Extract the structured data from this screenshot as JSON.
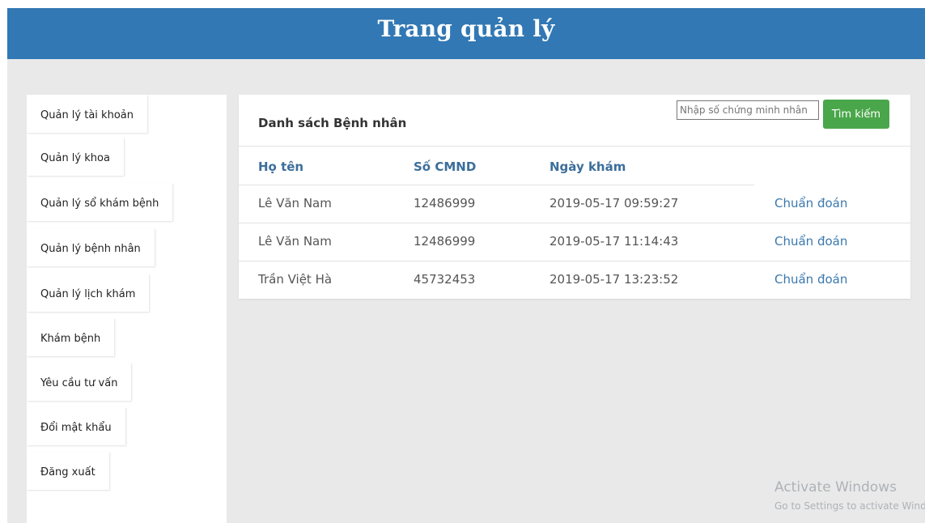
{
  "header": {
    "title": "Trang quản lý"
  },
  "sidebar": {
    "items": [
      {
        "label": "Quản lý tài khoản"
      },
      {
        "label": "Quản lý khoa"
      },
      {
        "label": "Quản lý sổ khám bệnh"
      },
      {
        "label": "Quản lý bệnh nhân"
      },
      {
        "label": "Quản lý lịch khám"
      },
      {
        "label": "Khám bệnh"
      },
      {
        "label": "Yêu cầu tư vấn"
      },
      {
        "label": "Đổi mật khẩu"
      },
      {
        "label": "Đăng xuất"
      }
    ]
  },
  "panel": {
    "title": "Danh sách Bệnh nhân",
    "search": {
      "placeholder": "Nhập số chứng minh nhân",
      "button": "Tìm kiếm"
    },
    "columns": [
      "Họ tên",
      "Số CMND",
      "Ngày khám"
    ],
    "rows": [
      {
        "name": "Lê Văn Nam",
        "cmnd": "12486999",
        "date": "2019-05-17 09:59:27",
        "action": "Chuẩn đoán"
      },
      {
        "name": "Lê Văn Nam",
        "cmnd": "12486999",
        "date": "2019-05-17 11:14:43",
        "action": "Chuẩn đoán"
      },
      {
        "name": "Trần Việt Hà",
        "cmnd": "45732453",
        "date": "2019-05-17 13:23:52",
        "action": "Chuẩn đoán"
      }
    ]
  },
  "watermark": {
    "line1": "Activate Windows",
    "line2": "Go to Settings to activate Windows."
  },
  "colors": {
    "header": "#3178b4",
    "button": "#4aa64a",
    "link": "#3a78ad"
  }
}
